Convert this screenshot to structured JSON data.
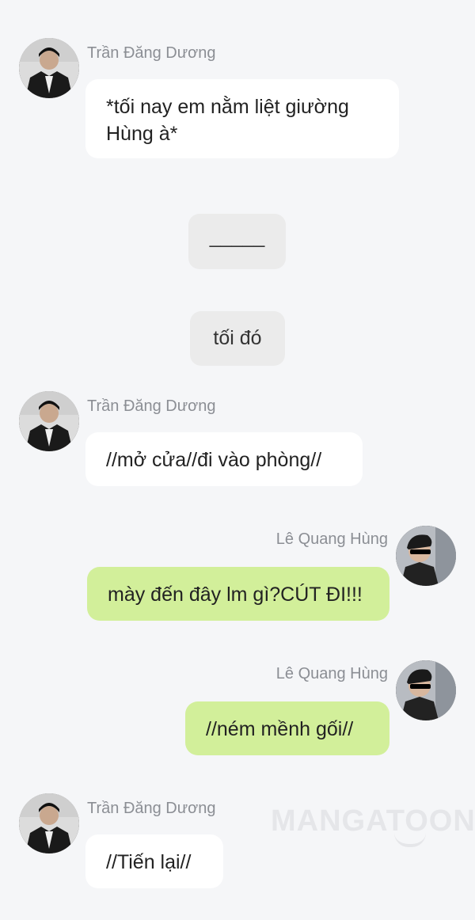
{
  "messages": [
    {
      "sender": "Trần Đăng Dương",
      "text": "*tối nay em nằm liệt giường Hùng à*"
    },
    {
      "narration": "_____"
    },
    {
      "narration": "tối đó"
    },
    {
      "sender": "Trần Đăng Dương",
      "text": "//mở cửa//đi vào phòng//"
    },
    {
      "sender": "Lê Quang Hùng",
      "text": "mày đến đây lm gì?CÚT ĐI!!!"
    },
    {
      "sender": "Lê Quang Hùng",
      "text": "//ném mềnh gối//"
    },
    {
      "sender": "Trần Đăng Dương",
      "text": "//Tiến lại//"
    }
  ],
  "watermark": "MANGATOON",
  "colors": {
    "background": "#f5f6f8",
    "left_bubble": "#ffffff",
    "right_bubble": "#d2ef9a",
    "narration_box": "#ebebeb",
    "name_text": "#8b8e94"
  }
}
